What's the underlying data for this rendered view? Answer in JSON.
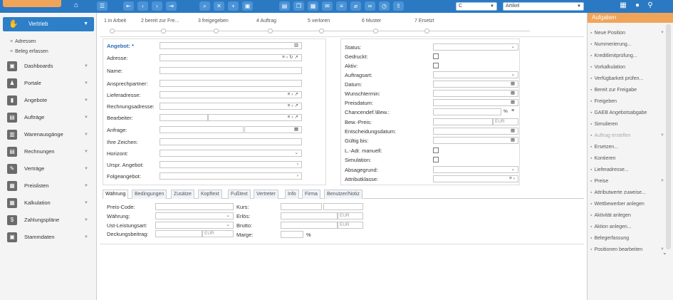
{
  "topbar": {
    "combo1": "C",
    "combo2": "Artikel"
  },
  "sidebar": {
    "active": "Vertrieb",
    "subs": [
      "Adressen",
      "Beleg erfassen"
    ],
    "items": [
      "Dashboards",
      "Portale",
      "Angebote",
      "Aufträge",
      "Warenausgänge",
      "Rechnungen",
      "Verträge",
      "Preislisten",
      "Kalkulation",
      "Zahlungspläne",
      "Stammdaten"
    ]
  },
  "steps": [
    "1 in Arbeit",
    "2 bereit zur Fre...",
    "3 freigegeben",
    "4 Auftrag",
    "5 verloren",
    "6 Muster",
    "7 Ersetzt"
  ],
  "form_left": {
    "angebot": "Angebot: *",
    "adresse": "Adresse:",
    "name": "Name:",
    "ansprechpartner": "Ansprechpartner:",
    "lieferadresse": "Lieferadresse:",
    "rechnungsadresse": "Rechnungsadresse:",
    "bearbeiter": "Bearbeiter:",
    "anfrage": "Anfrage:",
    "ihre_zeichen": "Ihre Zeichen:",
    "horizont": "Horizont:",
    "urspr_angebot": "Urspr. Angebot:",
    "folgeangebot": "Folgeangebot:"
  },
  "form_right": {
    "status": "Status:",
    "gedruckt": "Gedruckt:",
    "aktiv": "Aktiv:",
    "auftragsart": "Auftragsart:",
    "datum": "Datum:",
    "wunschtermin": "Wunschtermin:",
    "preisdatum": "Preisdatum:",
    "chancendef": "Chancendef.\\Bew.:",
    "bew_preis": "Bew.-Preis:",
    "entscheidungsdatum": "Entscheidungsdatum:",
    "gueltig_bis": "Gültig bis:",
    "ladr_manuell": "L.-Adr. manuell:",
    "simulation": "Simulation:",
    "absagegrund": "Absagegrund:",
    "attributklasse": "Attributklasse:",
    "eur": "EUR",
    "pct": "%"
  },
  "tabs": [
    "Währung",
    "Bedingungen",
    "Zusätze",
    "Kopftext",
    "Fußtext",
    "Vertreter",
    "Info",
    "Firma",
    "Benutzer/Notiz"
  ],
  "currency": {
    "preis_code": "Preis-Code:",
    "waehrung": "Währung:",
    "ust": "Ust-Leistungsart:",
    "deckungsbeitrag": "Deckungsbeitrag:",
    "eur": "EUR",
    "kurs": "Kurs:",
    "erlos": "Erlös:",
    "brutto": "Brutto:",
    "marge": "Marge:",
    "pct": "%"
  },
  "rightpanel": {
    "title": "Aufgaben",
    "items": [
      "Neue Position",
      "Nummerierung...",
      "Kreditlimitprüfung...",
      "Vorkalkulation",
      "Verfügbarkeit prüfen...",
      "Bereit zur Freigabe",
      "Freigeben",
      "GAEB Angebotsabgabe",
      "Simulieren",
      "Auftrag erstellen",
      "Ersetzen...",
      "Kontieren",
      "Lieferadresse...",
      "Preise",
      "Attributwerte zuweise...",
      "Wettbewerber anlegen",
      "Aktivität anlegen",
      "Aktion anlegen...",
      "Belegerfassung",
      "Positionen bearbeiten"
    ]
  }
}
